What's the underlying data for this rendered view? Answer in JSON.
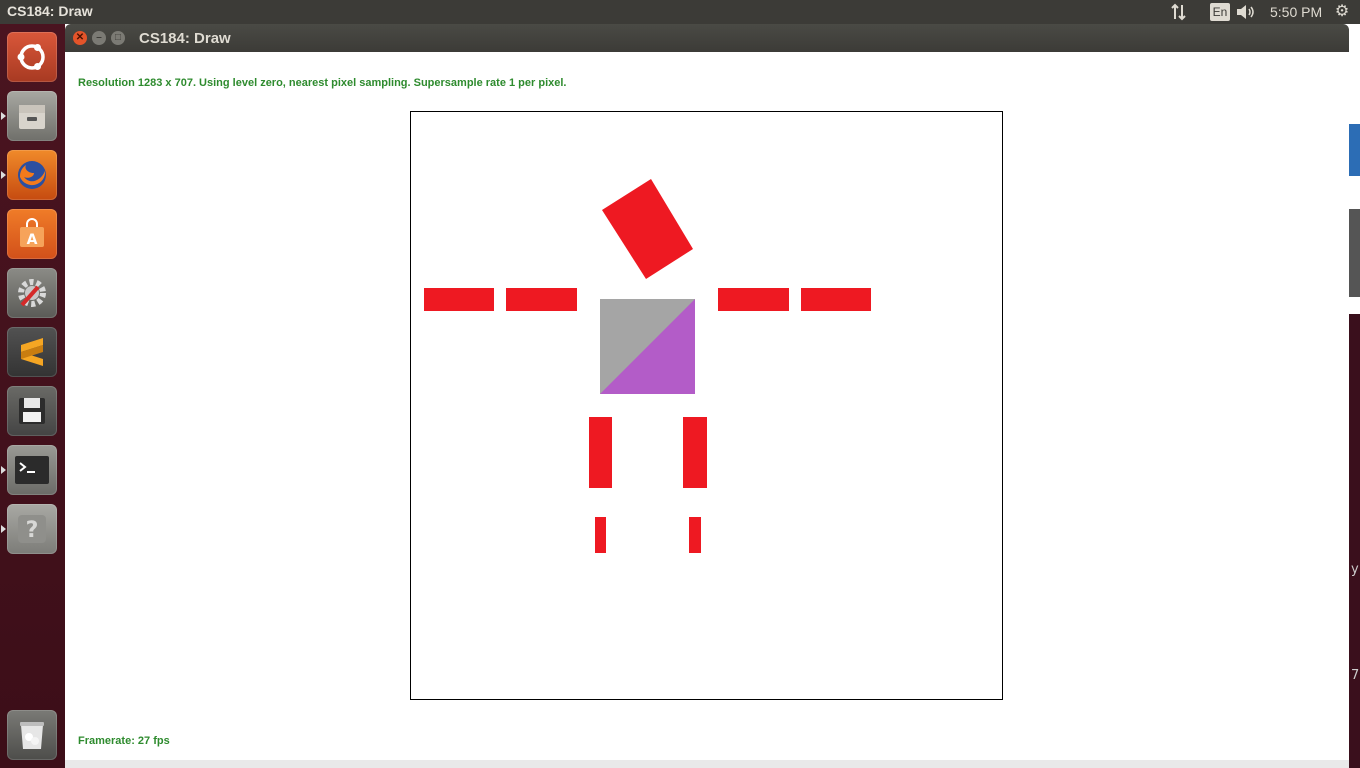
{
  "topbar": {
    "app_title": "CS184: Draw",
    "keyboard_layout": "En",
    "clock": "5:50 PM"
  },
  "launcher": {
    "items": [
      {
        "icon": "ubuntu-dash-icon",
        "color": "#c44a2b"
      },
      {
        "icon": "files-icon",
        "color": "#8a8a85"
      },
      {
        "icon": "firefox-icon",
        "color": "#e8701a"
      },
      {
        "icon": "software-center-icon",
        "color": "#e36a1c"
      },
      {
        "icon": "system-settings-icon",
        "color": "#7b7b7b"
      },
      {
        "icon": "sublime-text-icon",
        "color": "#4a4a4a"
      },
      {
        "icon": "save-disk-icon",
        "color": "#5a5a5a"
      },
      {
        "icon": "terminal-icon",
        "color": "#2d2d2d"
      },
      {
        "icon": "help-icon",
        "color": "#7b7b7b"
      },
      {
        "icon": "trash-icon",
        "color": "#6b6b6b"
      }
    ]
  },
  "window": {
    "title": "CS184: Draw",
    "status_top": "Resolution 1283 x 707. Using level zero, nearest pixel sampling. Supersample rate 1 per pixel.",
    "status_bottom": "Framerate: 27 fps"
  },
  "scene": {
    "fill_red": "#ee1922",
    "fill_grey": "#a5a5a5",
    "fill_purple": "#b35cc8",
    "border": "#000000"
  },
  "side_edge": {
    "text_1": "y",
    "text_2": "7"
  }
}
